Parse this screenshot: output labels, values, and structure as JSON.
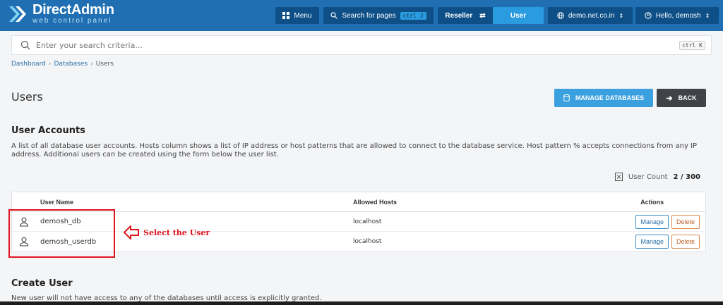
{
  "brand": {
    "title": "DirectAdmin",
    "subtitle": "web control panel"
  },
  "nav": {
    "menu_label": "Menu",
    "search_label": "Search for pages",
    "search_kbd": "ctrl J",
    "reseller_label": "Reseller",
    "user_label": "User",
    "domain_label": "demo.net.co.in",
    "hello_label": "Hello, demosh"
  },
  "search": {
    "placeholder": "Enter your search criteria...",
    "kbd": "ctrl K"
  },
  "breadcrumb": {
    "items": [
      "Dashboard",
      "Databases",
      "Users"
    ]
  },
  "page": {
    "title": "Users",
    "manage_db_label": "MANAGE DATABASES",
    "back_label": "BACK"
  },
  "accounts": {
    "title": "User Accounts",
    "description": "A list of all database user accounts. Hosts column shows a list of IP address or host patterns that are allowed to connect to the database service. Host pattern % accepts connections from any IP address. Additional users can be created using the form below the user list.",
    "count_label": "User Count",
    "count_value": "2 / 300"
  },
  "table": {
    "headers": {
      "name": "User Name",
      "hosts": "Allowed Hosts",
      "actions": "Actions"
    },
    "rows": [
      {
        "name": "demosh_db",
        "hosts": "localhost",
        "manage": "Manage",
        "delete": "Delete"
      },
      {
        "name": "demosh_userdb",
        "hosts": "localhost",
        "manage": "Manage",
        "delete": "Delete"
      }
    ]
  },
  "annotation": {
    "text": "Select the User",
    "color": "#e0141e"
  },
  "create": {
    "title": "Create User",
    "description": "New user will not have access to any of the databases until access is explicitly granted."
  },
  "colors": {
    "header": "#1f6fb2",
    "accent": "#3aa0e0",
    "dark_button": "#3f4347"
  }
}
